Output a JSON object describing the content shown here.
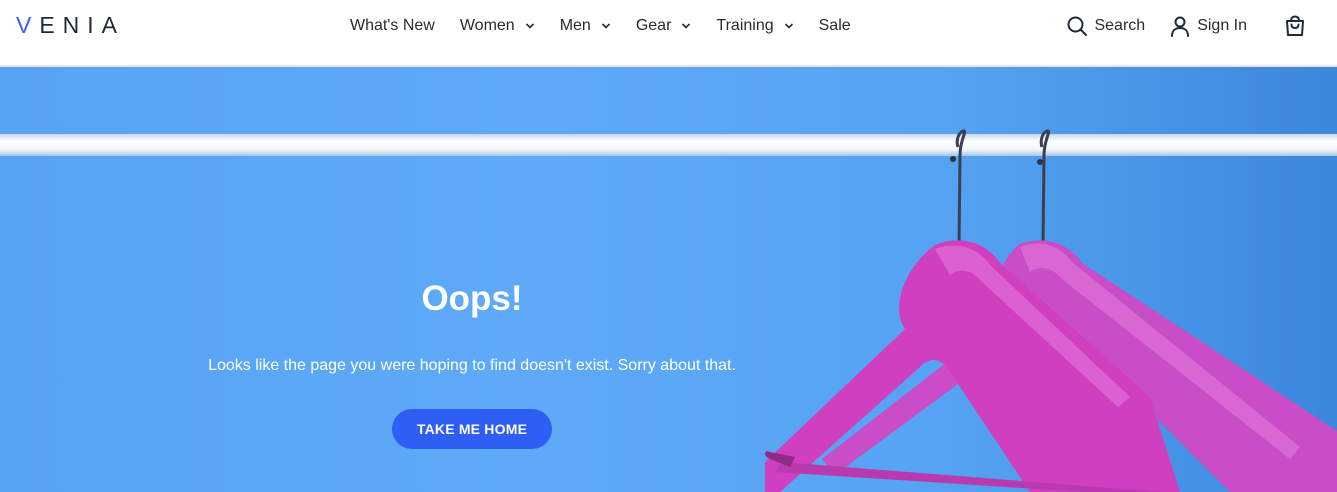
{
  "header": {
    "logo": {
      "first": "V",
      "rest": "ENIA"
    },
    "nav": [
      {
        "label": "What's New",
        "has_dropdown": false
      },
      {
        "label": "Women",
        "has_dropdown": true
      },
      {
        "label": "Men",
        "has_dropdown": true
      },
      {
        "label": "Gear",
        "has_dropdown": true
      },
      {
        "label": "Training",
        "has_dropdown": true
      },
      {
        "label": "Sale",
        "has_dropdown": false
      }
    ],
    "search_label": "Search",
    "sign_in_label": "Sign In",
    "icons": {
      "search": "search-icon",
      "account": "user-icon",
      "cart": "shopping-bag-icon",
      "dropdown": "chevron-down-icon"
    }
  },
  "hero": {
    "title": "Oops!",
    "message": "Looks like the page you were hoping to find doesn't exist. Sorry about that.",
    "button_label": "TAKE ME HOME"
  },
  "colors": {
    "accent": "#2f5ef5",
    "hero_background": "#5eaaf8",
    "hanger": "#d23fc0",
    "logo_v": "#3f5efb"
  }
}
